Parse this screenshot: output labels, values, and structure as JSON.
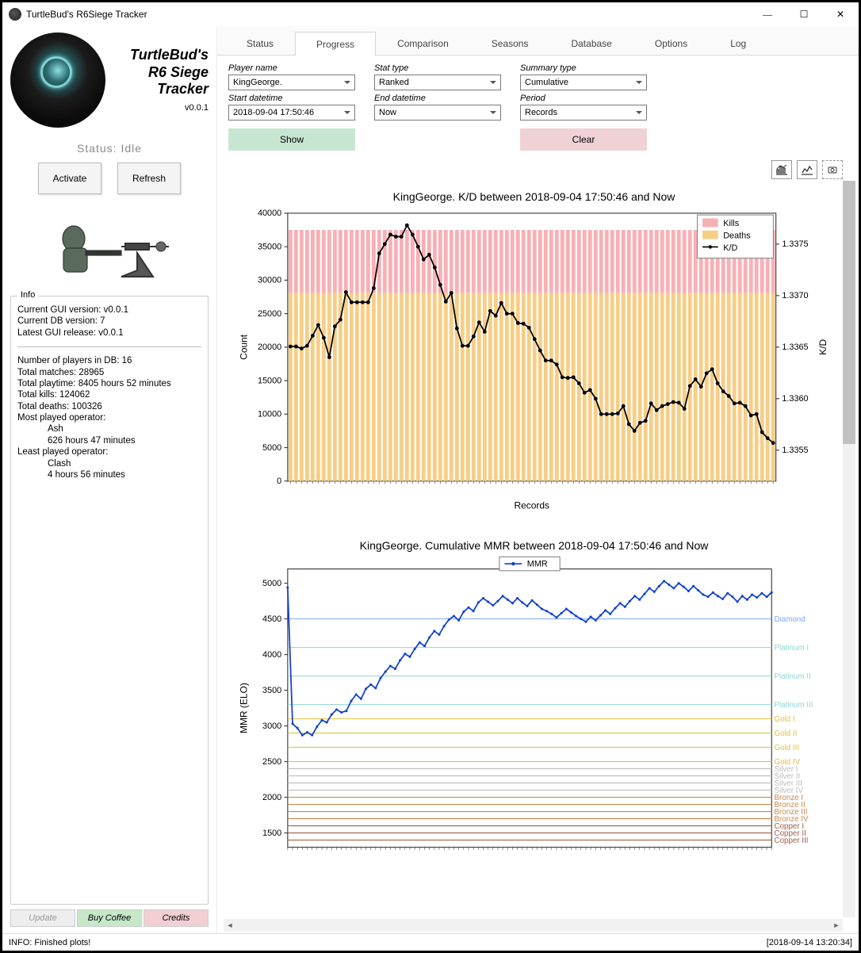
{
  "window": {
    "title": "TurtleBud's R6Siege Tracker"
  },
  "sidebar": {
    "app_title_l1": "TurtleBud's",
    "app_title_l2": "R6 Siege",
    "app_title_l3": "Tracker",
    "version": "v0.0.1",
    "status": "Status:  Idle",
    "activate": "Activate",
    "refresh": "Refresh",
    "info_heading": "Info",
    "info_lines": {
      "gui_ver": "Current GUI version: v0.0.1",
      "db_ver": "Current DB version: 7",
      "latest": "Latest GUI release: v0.0.1",
      "players": "Number of players in DB: 16",
      "matches": "Total matches: 28965",
      "playtime": "Total playtime: 8405 hours 52 minutes",
      "kills": "Total kills: 124062",
      "deaths": "Total deaths: 100326",
      "most_label": "Most played operator:",
      "most_op": "Ash",
      "most_time": "626 hours 47 minutes",
      "least_label": "Least played operator:",
      "least_op": "Clash",
      "least_time": "4 hours 56 minutes"
    },
    "update": "Update",
    "coffee": "Buy Coffee",
    "credits": "Credits"
  },
  "tabs": [
    "Status",
    "Progress",
    "Comparison",
    "Seasons",
    "Database",
    "Options",
    "Log"
  ],
  "active_tab": "Progress",
  "controls": {
    "player_label": "Player name",
    "player_value": "KingGeorge.",
    "stat_label": "Stat type",
    "stat_value": "Ranked",
    "summary_label": "Summary type",
    "summary_value": "Cumulative",
    "start_label": "Start datetime",
    "start_value": "2018-09-04 17:50:46",
    "end_label": "End datetime",
    "end_value": "Now",
    "period_label": "Period",
    "period_value": "Records",
    "show": "Show",
    "clear": "Clear"
  },
  "statusbar": {
    "msg": "INFO: Finished plots!",
    "ts": "[2018-09-14 13:20:34]"
  },
  "chart_data": [
    {
      "type": "bar+line",
      "title": "KingGeorge. K/D between 2018-09-04 17:50:46 and Now",
      "xlabel": "Records",
      "ylabel_left": "Count",
      "ylabel_right": "K/D",
      "ylim_left": [
        0,
        40000
      ],
      "ylim_right": [
        1.3352,
        1.3378
      ],
      "yticks_left": [
        0,
        5000,
        10000,
        15000,
        20000,
        25000,
        30000,
        35000,
        40000
      ],
      "yticks_right": [
        1.3355,
        1.336,
        1.3365,
        1.337,
        1.3375
      ],
      "background_bars": {
        "kills_top": 37500,
        "deaths_top": 28100
      },
      "legend": [
        "Kills",
        "Deaths",
        "K/D"
      ],
      "colors": {
        "Kills": "#f8b0b5",
        "Deaths": "#f6ce87",
        "K/D": "#000000"
      },
      "series": [
        {
          "name": "K/D_as_Count",
          "values": [
            20100,
            20100,
            19800,
            20200,
            21700,
            23300,
            21400,
            18500,
            23100,
            24100,
            28200,
            26700,
            26700,
            26700,
            26700,
            28800,
            34000,
            35400,
            36800,
            36500,
            36500,
            38200,
            36800,
            35000,
            33100,
            33800,
            31900,
            29300,
            26800,
            28100,
            22800,
            20200,
            20200,
            21600,
            23700,
            22300,
            25400,
            24700,
            26600,
            25000,
            25000,
            23600,
            23500,
            22900,
            21200,
            19500,
            18000,
            18000,
            17400,
            15500,
            15400,
            15500,
            14600,
            13200,
            13600,
            12300,
            10000,
            10000,
            10000,
            10100,
            11200,
            8500,
            7500,
            8700,
            9000,
            11600,
            10600,
            11200,
            11500,
            11800,
            11700,
            10800,
            14200,
            15200,
            14100,
            16100,
            16700,
            14600,
            13400,
            12700,
            11600,
            11700,
            11200,
            9800,
            10000,
            7300,
            6400,
            5700
          ]
        }
      ]
    },
    {
      "type": "line",
      "title": "KingGeorge. Cumulative MMR between 2018-09-04 17:50:46 and Now",
      "xlabel": "",
      "ylabel": "MMR (ELO)",
      "ylim": [
        1300,
        5200
      ],
      "yticks": [
        1500,
        2000,
        2500,
        3000,
        3500,
        4000,
        4500,
        5000
      ],
      "legend": [
        "MMR"
      ],
      "colors": {
        "MMR": "#1040d0"
      },
      "rank_lines": [
        {
          "label": "Diamond",
          "y": 4500,
          "color": "#7aa9ff"
        },
        {
          "label": "Platinum I",
          "y": 4100,
          "color": "#8fd6d0"
        },
        {
          "label": "Platinum II",
          "y": 3700,
          "color": "#8fd6d0"
        },
        {
          "label": "Platinum III",
          "y": 3300,
          "color": "#8fd6d0"
        },
        {
          "label": "Gold I",
          "y": 3100,
          "color": "#e2c23a"
        },
        {
          "label": "Gold II",
          "y": 2900,
          "color": "#e2c23a"
        },
        {
          "label": "Gold III",
          "y": 2700,
          "color": "#e2c23a"
        },
        {
          "label": "Gold IV",
          "y": 2500,
          "color": "#e2c23a"
        },
        {
          "label": "Silver I",
          "y": 2400,
          "color": "#bcbcbc"
        },
        {
          "label": "Silver II",
          "y": 2300,
          "color": "#bcbcbc"
        },
        {
          "label": "Silver III",
          "y": 2200,
          "color": "#bcbcbc"
        },
        {
          "label": "Silver IV",
          "y": 2100,
          "color": "#bcbcbc"
        },
        {
          "label": "Bronze I",
          "y": 2000,
          "color": "#c68a4e"
        },
        {
          "label": "Bronze II",
          "y": 1900,
          "color": "#c68a4e"
        },
        {
          "label": "Bronze III",
          "y": 1800,
          "color": "#c68a4e"
        },
        {
          "label": "Bronze IV",
          "y": 1700,
          "color": "#c68a4e"
        },
        {
          "label": "Copper I",
          "y": 1600,
          "color": "#a0604a"
        },
        {
          "label": "Copper II",
          "y": 1500,
          "color": "#a0604a"
        },
        {
          "label": "Copper III",
          "y": 1400,
          "color": "#a0604a"
        }
      ],
      "series": [
        {
          "name": "MMR",
          "values": [
            4940,
            3030,
            2970,
            2870,
            2910,
            2870,
            2990,
            3080,
            3050,
            3160,
            3230,
            3190,
            3210,
            3350,
            3440,
            3380,
            3520,
            3580,
            3530,
            3670,
            3760,
            3840,
            3800,
            3920,
            4010,
            3970,
            4080,
            4170,
            4120,
            4240,
            4330,
            4280,
            4400,
            4490,
            4540,
            4480,
            4600,
            4660,
            4610,
            4730,
            4790,
            4740,
            4690,
            4750,
            4820,
            4770,
            4720,
            4790,
            4730,
            4680,
            4760,
            4700,
            4640,
            4610,
            4570,
            4520,
            4580,
            4640,
            4590,
            4540,
            4500,
            4460,
            4530,
            4480,
            4550,
            4620,
            4570,
            4650,
            4720,
            4670,
            4750,
            4820,
            4770,
            4850,
            4930,
            4880,
            4960,
            5030,
            4980,
            4930,
            5000,
            4950,
            4890,
            4960,
            4900,
            4840,
            4810,
            4870,
            4820,
            4780,
            4860,
            4810,
            4740,
            4820,
            4770,
            4840,
            4800,
            4860,
            4810,
            4870
          ]
        }
      ]
    }
  ]
}
